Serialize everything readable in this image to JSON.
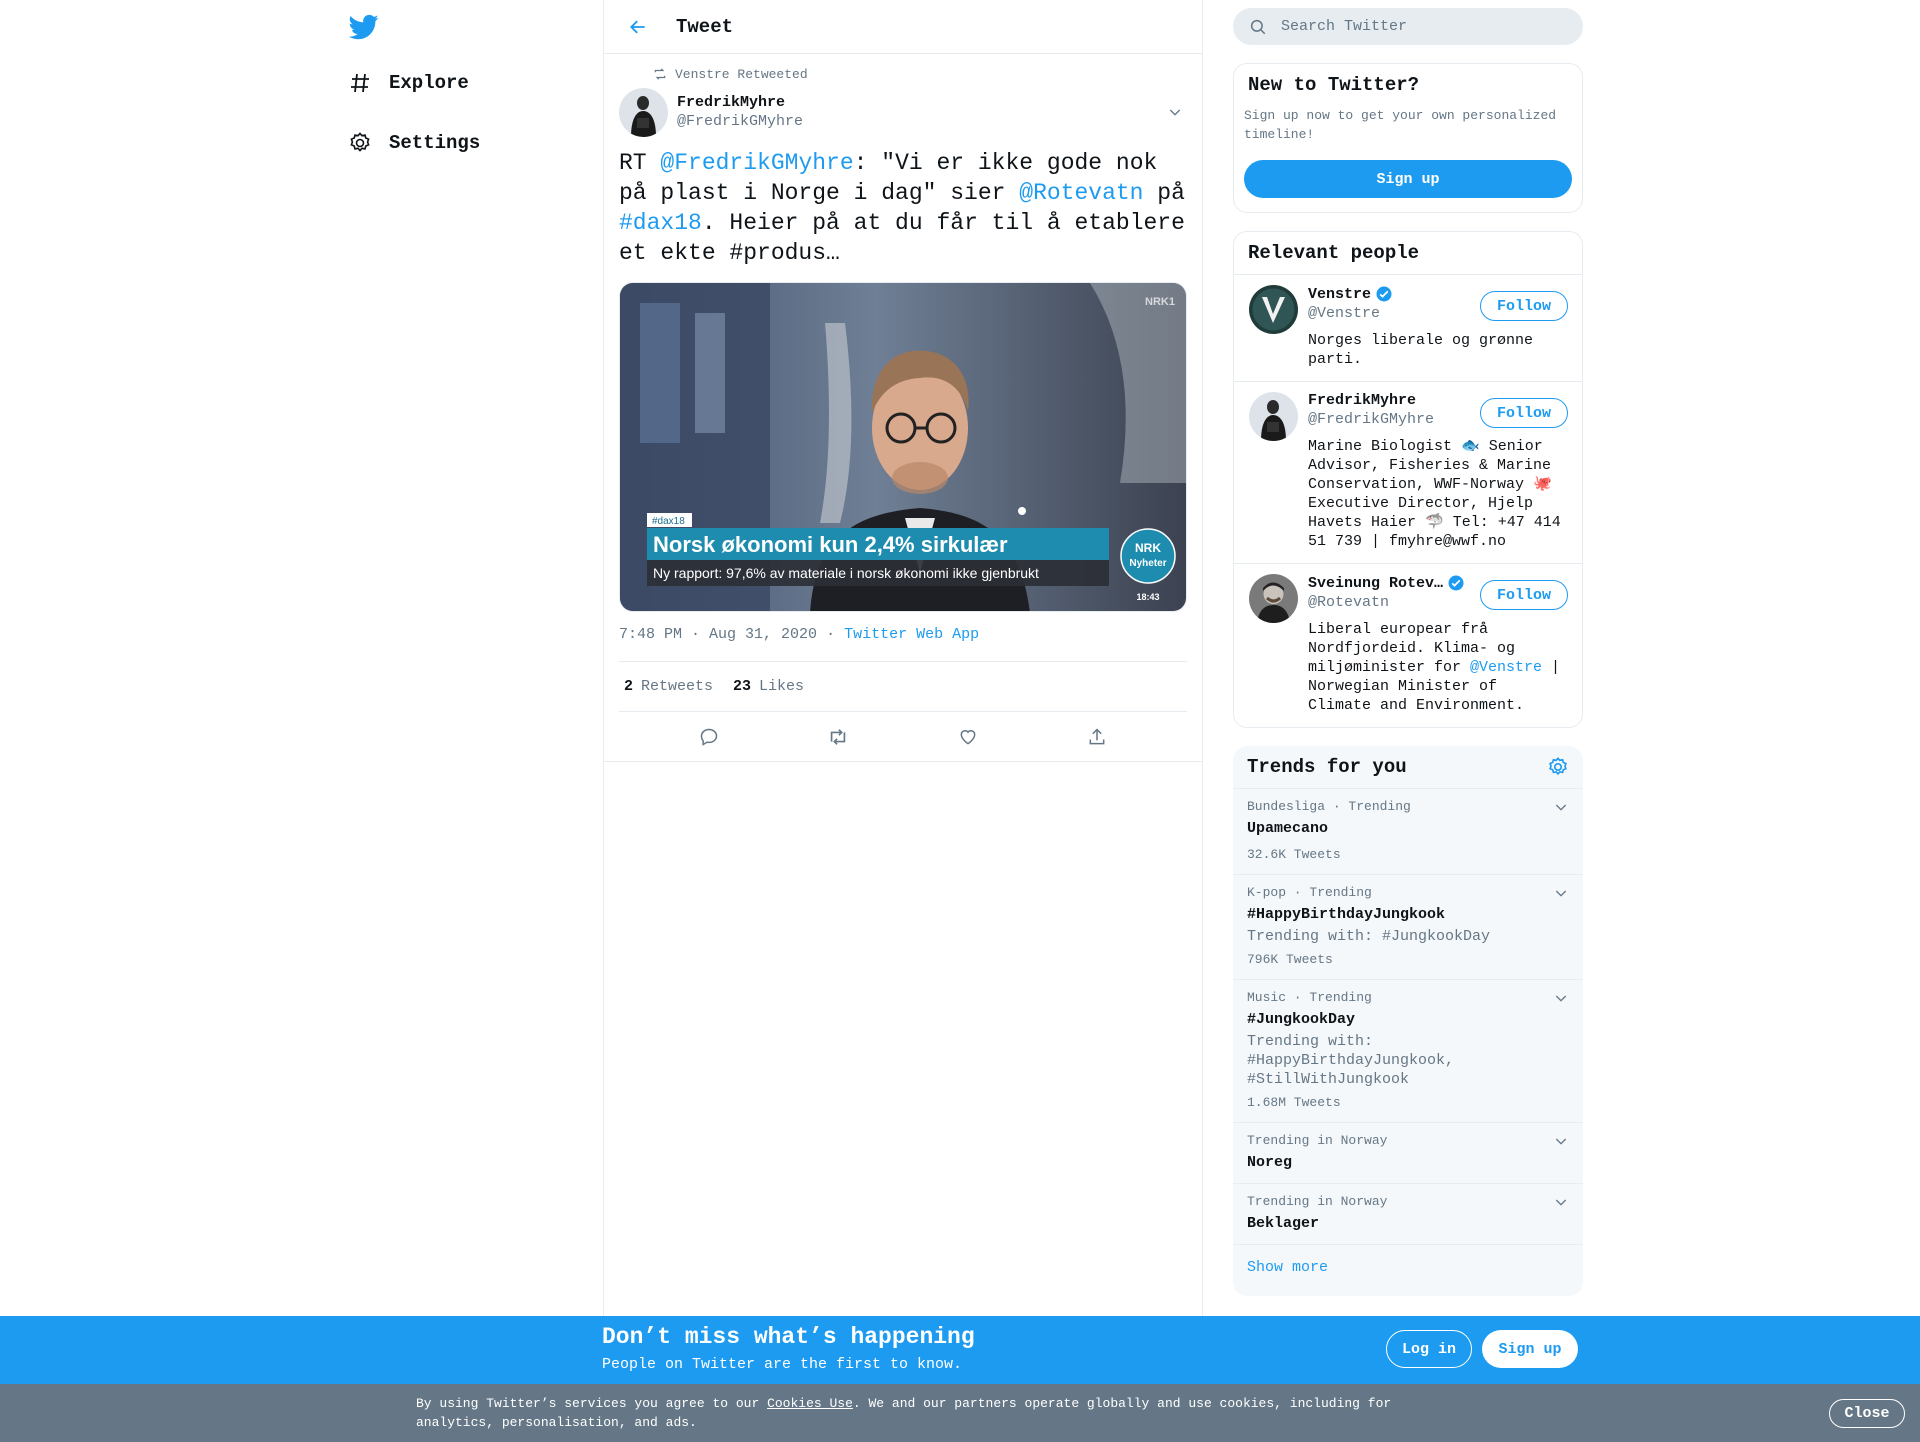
{
  "nav": {
    "items": [
      {
        "label": "Explore"
      },
      {
        "label": "Settings"
      }
    ]
  },
  "header": {
    "title": "Tweet"
  },
  "tweet": {
    "retweet_context": "Venstre Retweeted",
    "author_name": "FredrikMyhre",
    "author_handle": "@FredrikGMyhre",
    "text_parts": [
      {
        "text": "RT ",
        "link": false
      },
      {
        "text": "@FredrikGMyhre",
        "link": true
      },
      {
        "text": ": \"Vi er ikke gode nok på plast i Norge i dag\" sier ",
        "link": false
      },
      {
        "text": "@Rotevatn",
        "link": true
      },
      {
        "text": " på ",
        "link": false
      },
      {
        "text": "#dax18",
        "link": true
      },
      {
        "text": ". Heier på at du får til å etablere et ekte #produs…",
        "link": false
      }
    ],
    "media": {
      "hashtag_badge": "#dax18",
      "headline": "Norsk økonomi kun 2,4% sirkulær",
      "subline": "Ny rapport: 97,6% av materiale i norsk økonomi ikke gjenbrukt",
      "logo_top": "NRK",
      "logo_bottom": "Nyheter",
      "corner_logo": "NRK1",
      "clock": "18:43"
    },
    "timestamp": "7:48 PM · Aug 31, 2020",
    "separator": "·",
    "source": "Twitter Web App",
    "retweets_count": "2",
    "retweets_label": "Retweets",
    "likes_count": "23",
    "likes_label": "Likes"
  },
  "search": {
    "placeholder": "Search Twitter"
  },
  "new_to_twitter": {
    "title": "New to Twitter?",
    "subtitle": "Sign up now to get your own personalized timeline!",
    "button": "Sign up"
  },
  "relevant_people": {
    "title": "Relevant people",
    "people": [
      {
        "name": "Venstre",
        "verified": true,
        "handle": "@Venstre",
        "bio": "Norges liberale og grønne parti.",
        "follow": "Follow"
      },
      {
        "name": "FredrikMyhre",
        "verified": false,
        "handle": "@FredrikGMyhre",
        "bio": "Marine Biologist 🐟 Senior Advisor, Fisheries & Marine Conservation, WWF-Norway 🐙 Executive Director, Hjelp Havets Haier 🦈 Tel: +47 414 51 739 | fmyhre@wwf.no",
        "follow": "Follow"
      },
      {
        "name": "Sveinung Rotev…",
        "verified": true,
        "handle": "@Rotevatn",
        "bio_before": "Liberal europear frå Nordfjordeid. Klima- og miljøminister for ",
        "bio_link": "@Venstre",
        "bio_after": " | Norwegian Minister of Climate and Environment.",
        "follow": "Follow"
      }
    ]
  },
  "trends": {
    "title": "Trends for you",
    "items": [
      {
        "context": "Bundesliga · Trending",
        "name": "Upamecano",
        "with": "",
        "count": "32.6K Tweets"
      },
      {
        "context": "K-pop · Trending",
        "name": "#HappyBirthdayJungkook",
        "with": "Trending with: #JungkookDay",
        "count": "796K Tweets"
      },
      {
        "context": "Music · Trending",
        "name": "#JungkookDay",
        "with": "Trending with: #HappyBirthdayJungkook, #StillWithJungkook",
        "count": "1.68M Tweets"
      },
      {
        "context": "Trending in Norway",
        "name": "Noreg",
        "with": "",
        "count": ""
      },
      {
        "context": "Trending in Norway",
        "name": "Beklager",
        "with": "",
        "count": ""
      }
    ],
    "show_more": "Show more"
  },
  "banner": {
    "title": "Don’t miss what’s happening",
    "subtitle": "People on Twitter are the first to know.",
    "login": "Log in",
    "signup": "Sign up"
  },
  "cookie": {
    "text_before": "By using Twitter’s services you agree to our ",
    "link": "Cookies Use",
    "text_after": ". We and our partners operate globally and use cookies, including for analytics, personalisation, and ads.",
    "close": "Close"
  },
  "colors": {
    "accent": "#1d9bf0",
    "muted": "#657786",
    "border": "#e6ecf0",
    "cookie_bg": "#657786"
  }
}
